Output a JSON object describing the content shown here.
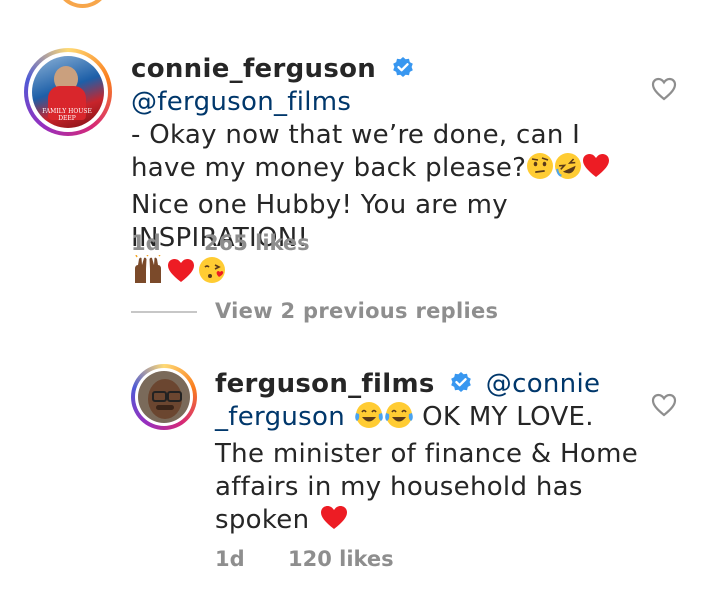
{
  "comment1": {
    "username": "connie_ferguson",
    "mention": "@ferguson_films",
    "text_part1": "- Okay now that we’re done, can I have my money back please?",
    "text_part2": " Nice one Hubby! You are my INSPIRATION!",
    "time": "1d",
    "likes": "265 likes",
    "avatar_caption": "FAMILY HOUSE DEEP"
  },
  "view_replies": "View 2 previous replies",
  "comment2": {
    "username": "ferguson_films",
    "mention_line1": "@connie",
    "mention_line2": "_ferguson",
    "text_part1": " OK MY LOVE.",
    "text_line3": "The minister of finance & Home",
    "text_line4": "affairs in my household has",
    "text_line5": "spoken",
    "time": "1d",
    "likes": "120 likes"
  },
  "colors": {
    "mention": "#00376b",
    "meta": "#8e8e8e",
    "verified": "#3897f0",
    "heart": "#ed1c24"
  }
}
